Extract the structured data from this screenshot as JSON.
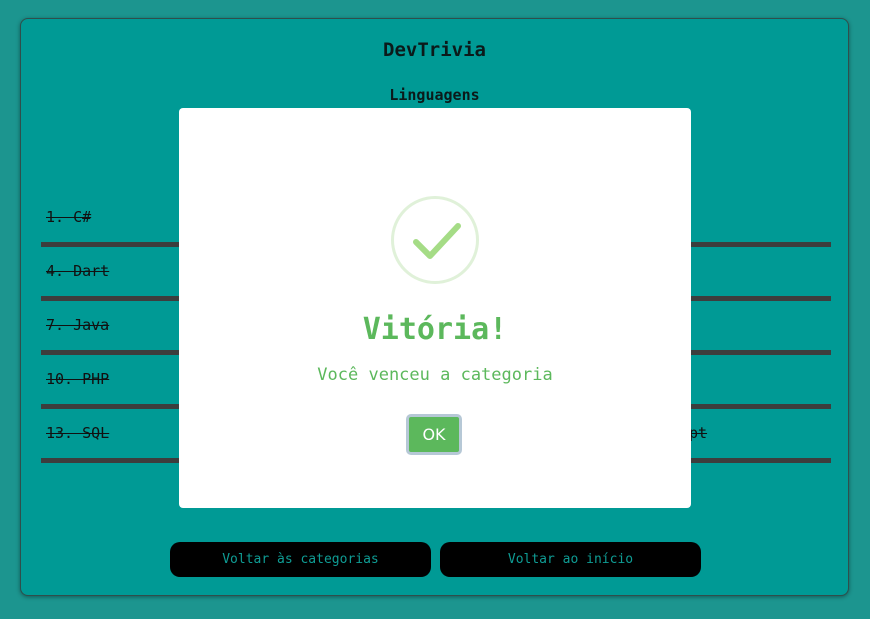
{
  "app": {
    "title": "DevTrivia"
  },
  "category": {
    "title": "Linguagens"
  },
  "list": {
    "rows": [
      {
        "left": "1. C#"
      },
      {
        "left": "4. Dart"
      },
      {
        "left": "7. Java"
      },
      {
        "left": "10. PHP"
      },
      {
        "left": "13. SQL",
        "right": "pt"
      }
    ]
  },
  "footer": {
    "back_categories": "Voltar às categorias",
    "back_home": "Voltar ao início"
  },
  "modal": {
    "icon": "check-icon",
    "title": "Vitória!",
    "message": "Você venceu a categoria",
    "ok_label": "OK",
    "accent_color": "#5cb85c"
  },
  "colors": {
    "background": "#1c958f",
    "card": "#009a95",
    "divider": "#3d3d3d",
    "button_bg": "#000000"
  }
}
